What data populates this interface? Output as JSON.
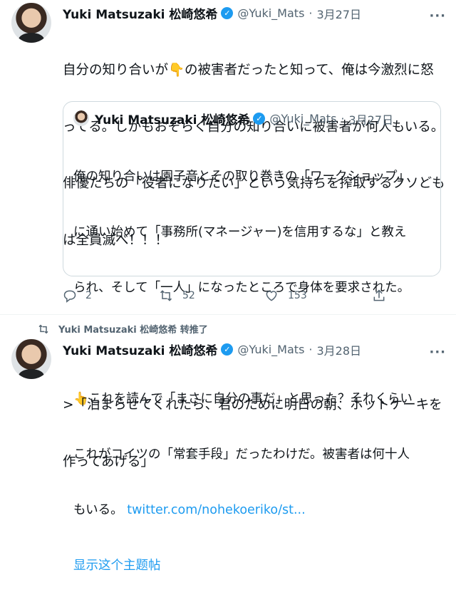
{
  "tweet1": {
    "name": "Yuki Matsuzaki 松崎悠希",
    "handle": "@Yuki_Mats",
    "date": "3月27日",
    "text_line1": "自分の知り合いが👇の被害者だったと知って、俺は今激烈に怒",
    "text_line2": "ってる。しかもおそらく自分の知り合いに被害者が何人もいる。",
    "text_line3": "俳優たちの「役者になりたい」という気持ちを搾取するクソども",
    "text_line4": "は全員滅べ！！！"
  },
  "quote": {
    "name": "Yuki Matsuzaki 松崎悠希",
    "handle": "@Yuki_Mats",
    "date": "3月27日",
    "line1": "俺の知り合いは園子音とその取り巻きの「ワークショップ」",
    "line2": "に通い始めて「事務所(マネージャー)を信用するな」と教え",
    "line3": "られ、そして「一人」になったところで身体を要求された。",
    "line4": "👆これを読んで「まさに自分の事だ」と思った？それくらい",
    "line5": "これがコイツの「常套手段」だったわけだ。被害者は何十人",
    "line6_text": "もいる。 ",
    "line6_link": "twitter.com/nohekoeriko/st...",
    "show_thread": "显示这个主题帖"
  },
  "actions": {
    "replies": "2",
    "retweets": "52",
    "likes": "153"
  },
  "retweet_banner": "Yuki Matsuzaki 松崎悠希 转推了",
  "tweet2": {
    "name": "Yuki Matsuzaki 松崎悠希",
    "handle": "@Yuki_Mats",
    "date": "3月28日",
    "text_line1": ">「泊まらせてくれたら、君のために明日の朝、ホットケーキを",
    "text_line2": "作ってあげる」"
  },
  "icons": [
    "more-icon",
    "verified-badge-icon",
    "reply-icon",
    "retweet-icon",
    "like-icon",
    "share-icon"
  ],
  "colors": {
    "accent": "#1d9bf0",
    "text": "#0f1419",
    "secondary": "#536471",
    "border": "#cfd9de"
  }
}
